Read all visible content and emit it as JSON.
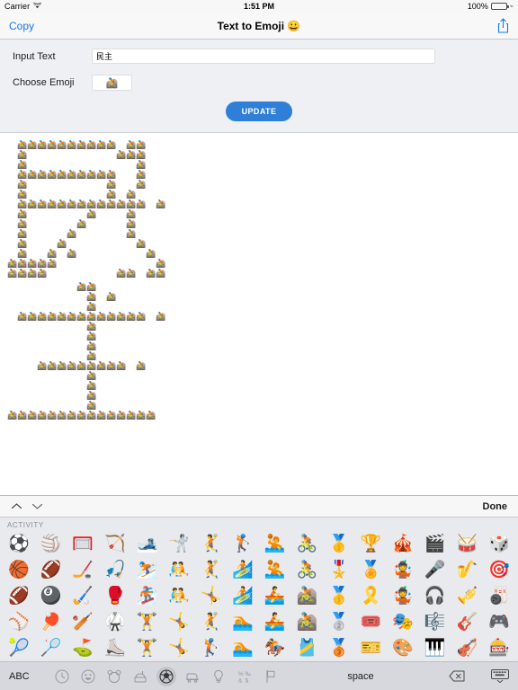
{
  "status_bar": {
    "carrier": "Carrier",
    "wifi_icon": "wifi-icon",
    "time": "1:51 PM",
    "battery_percent": "100%",
    "battery_level": 100,
    "charging": true
  },
  "nav_bar": {
    "left_button": "Copy",
    "title": "Text to Emoji 😀",
    "share_icon": "share-icon",
    "accent_color": "#1479ef"
  },
  "form": {
    "input_text_label": "Input Text",
    "input_text_value": "民主",
    "input_text_placeholder": "",
    "choose_emoji_label": "Choose Emoji",
    "chosen_emoji": "🚵",
    "update_label": "UPDATE",
    "update_color": "#2f7fd8"
  },
  "art": {
    "emoji": "🚵",
    "description": "Input text rendered as large characters built from repeated emoji",
    "characters": [
      {
        "char": "民",
        "grid": [
          "01111111111.11..",
          "01.........111..",
          "01...........1..",
          "01111111111..1..",
          "01........1..1..",
          "01........1.1...",
          "01111111111111.1",
          "01......1...1...",
          "01.....1....1...",
          "01....1.....1...",
          "01...1.......1..",
          "01..1.1.......1.",
          "11111..........1",
          "1111.......11.11"
        ]
      },
      {
        "char": "主",
        "grid": [
          ".......11.......",
          "........1.1.....",
          "........1.......",
          ".1111111111111.1",
          "........1.......",
          "........1.......",
          "........1.......",
          "........1.......",
          "...111111111.1..",
          "........1.......",
          "........1.......",
          "........1.......",
          "........1.......",
          "111111111111111."
        ]
      }
    ]
  },
  "keyboard": {
    "accessory": {
      "prev_icon": "chevron-up-icon",
      "next_icon": "chevron-down-icon",
      "done_label": "Done"
    },
    "category_label": "ACTIVITY",
    "emoji_rows": [
      [
        "⚽",
        "🏐",
        "🥅",
        "🏹",
        "🎿",
        "🤺",
        "🤾",
        "🏌️",
        "🤽",
        "🚴",
        "🥇",
        "🏆",
        "🎪",
        "🎬",
        "🥁",
        "🎲"
      ],
      [
        "🏀",
        "🏈",
        "🏒",
        "🎣",
        "⛷️",
        "🤼",
        "🤾",
        "🏄",
        "🤽",
        "🚴",
        "🎖️",
        "🏅",
        "🤹",
        "🎤",
        "🎷",
        "🎯"
      ],
      [
        "🏈",
        "🎱",
        "🏑",
        "🥊",
        "🏂",
        "🤼",
        "🤸",
        "🏄",
        "🚣",
        "🚵",
        "🥇",
        "🎗️",
        "🤹",
        "🎧",
        "🎺",
        "🎳"
      ],
      [
        "⚾",
        "🏓",
        "🏏",
        "🥋",
        "🏋️",
        "🤸",
        "🤾",
        "🏊",
        "🚣",
        "🚵",
        "🥈",
        "🎟️",
        "🎭",
        "🎼",
        "🎸",
        "🎮"
      ],
      [
        "🎾",
        "🏸",
        "⛳",
        "⛸️",
        "🏋️",
        "🤸",
        "🏌️",
        "🏊",
        "🏇",
        "🎽",
        "🥉",
        "🎫",
        "🎨",
        "🎹",
        "🎻",
        "🎰"
      ]
    ],
    "bottom_bar": {
      "abc_label": "ABC",
      "space_label": "space",
      "delete_icon": "delete-backward-icon",
      "dismiss_icon": "keyboard-dismiss-icon",
      "categories": [
        {
          "name": "recent",
          "icon": "clock-icon",
          "selected": false
        },
        {
          "name": "smileys",
          "icon": "smiley-icon",
          "selected": false
        },
        {
          "name": "animals",
          "icon": "bear-icon",
          "selected": false
        },
        {
          "name": "food",
          "icon": "food-icon",
          "selected": false
        },
        {
          "name": "activity",
          "icon": "soccer-ball-icon",
          "selected": true
        },
        {
          "name": "travel",
          "icon": "car-icon",
          "selected": false
        },
        {
          "name": "objects",
          "icon": "lightbulb-icon",
          "selected": false
        },
        {
          "name": "symbols",
          "icon": "symbols-icon",
          "selected": false
        },
        {
          "name": "flags",
          "icon": "flag-icon",
          "selected": false
        }
      ]
    }
  }
}
